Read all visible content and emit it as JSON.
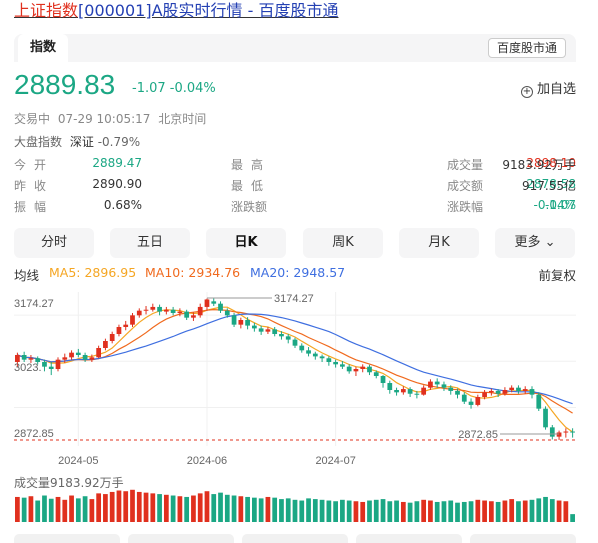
{
  "page": {
    "title_prefix": "上证指数",
    "title_link": "[000001]A股实时行情 - 百度股市通"
  },
  "header": {
    "tab_label": "指数",
    "source_tag": "百度股市通"
  },
  "quote": {
    "price": "2889.83",
    "change": "-1.07",
    "change_pct": "-0.04%",
    "add_fav": "加自选",
    "status": "交易中",
    "time": "07-29 10:05:17",
    "tz": "北京时间",
    "market_label": "大盘指数",
    "market_name": "深证",
    "market_pct": "-0.79%"
  },
  "stats": [
    [
      {
        "label": "今开",
        "value": "2889.47",
        "color": "#1ba784"
      },
      {
        "label": "最高",
        "value": "2898.10",
        "color": "#e0301e"
      },
      {
        "label": "成交量",
        "value": "9183.92万手",
        "color": "#333333"
      }
    ],
    [
      {
        "label": "昨收",
        "value": "2890.90",
        "color": "#333333"
      },
      {
        "label": "最低",
        "value": "2878.58",
        "color": "#1ba784"
      },
      {
        "label": "成交额",
        "value": "917.55亿",
        "color": "#333333"
      }
    ],
    [
      {
        "label": "振幅",
        "value": "0.68%",
        "color": "#333333"
      },
      {
        "label": "涨跌额",
        "value": "-1.07",
        "color": "#1ba784"
      },
      {
        "label": "涨跌幅",
        "value": "-0.04%",
        "color": "#1ba784"
      }
    ]
  ],
  "periods": [
    "分时",
    "五日",
    "日K",
    "周K",
    "月K",
    "更多"
  ],
  "active_period": "日K",
  "indicators": {
    "label": "均线",
    "ma5": "MA5: 2896.95",
    "ma10": "MA10: 2934.76",
    "ma20": "MA20: 2948.57",
    "adjust": "前复权"
  },
  "colors": {
    "up": "#e0301e",
    "down": "#1ba784",
    "ma5": "#f5a623",
    "ma10": "#f06a1e",
    "ma20": "#3f6fe0"
  },
  "chart_data": {
    "type": "candlestick",
    "y_high_label": "3174.27",
    "y_low_label": "2872.85",
    "y_mid_label": "3023.",
    "max_annotation": "3174.27",
    "min_annotation": "2872.85",
    "ylim": [
      2860,
      3190
    ],
    "x_labels": [
      "2024-05",
      "2024-06",
      "2024-07"
    ],
    "x_label_index": [
      9,
      28,
      47
    ],
    "candles": [
      [
        3040,
        3055,
        3030,
        3060
      ],
      [
        3055,
        3045,
        3040,
        3062
      ],
      [
        3045,
        3048,
        3038,
        3055
      ],
      [
        3048,
        3040,
        3035,
        3052
      ],
      [
        3040,
        3030,
        3020,
        3045
      ],
      [
        3030,
        3025,
        3012,
        3040
      ],
      [
        3025,
        3045,
        3020,
        3050
      ],
      [
        3045,
        3050,
        3038,
        3058
      ],
      [
        3050,
        3060,
        3045,
        3065
      ],
      [
        3060,
        3055,
        3050,
        3068
      ],
      [
        3055,
        3045,
        3040,
        3060
      ],
      [
        3045,
        3050,
        3040,
        3056
      ],
      [
        3050,
        3070,
        3048,
        3075
      ],
      [
        3070,
        3085,
        3065,
        3090
      ],
      [
        3085,
        3100,
        3080,
        3105
      ],
      [
        3100,
        3115,
        3095,
        3120
      ],
      [
        3115,
        3120,
        3108,
        3128
      ],
      [
        3120,
        3140,
        3115,
        3145
      ],
      [
        3140,
        3150,
        3135,
        3155
      ],
      [
        3150,
        3152,
        3142,
        3160
      ],
      [
        3152,
        3158,
        3148,
        3165
      ],
      [
        3158,
        3148,
        3140,
        3163
      ],
      [
        3148,
        3152,
        3142,
        3158
      ],
      [
        3152,
        3145,
        3140,
        3158
      ],
      [
        3145,
        3148,
        3138,
        3155
      ],
      [
        3148,
        3135,
        3130,
        3152
      ],
      [
        3135,
        3140,
        3128,
        3146
      ],
      [
        3140,
        3158,
        3135,
        3165
      ],
      [
        3158,
        3174,
        3150,
        3176
      ],
      [
        3170,
        3165,
        3160,
        3176
      ],
      [
        3165,
        3150,
        3145,
        3170
      ],
      [
        3150,
        3140,
        3135,
        3155
      ],
      [
        3140,
        3120,
        3115,
        3145
      ],
      [
        3120,
        3130,
        3112,
        3135
      ],
      [
        3130,
        3118,
        3110,
        3136
      ],
      [
        3118,
        3112,
        3105,
        3124
      ],
      [
        3112,
        3105,
        3098,
        3118
      ],
      [
        3105,
        3110,
        3100,
        3115
      ],
      [
        3110,
        3100,
        3095,
        3115
      ],
      [
        3100,
        3095,
        3088,
        3106
      ],
      [
        3095,
        3088,
        3080,
        3100
      ],
      [
        3088,
        3075,
        3070,
        3092
      ],
      [
        3075,
        3065,
        3060,
        3080
      ],
      [
        3065,
        3058,
        3052,
        3072
      ],
      [
        3058,
        3052,
        3045,
        3062
      ],
      [
        3052,
        3048,
        3040,
        3056
      ],
      [
        3048,
        3040,
        3032,
        3052
      ],
      [
        3040,
        3035,
        3028,
        3045
      ],
      [
        3035,
        3030,
        3025,
        3042
      ],
      [
        3030,
        3020,
        3015,
        3035
      ],
      [
        3020,
        3025,
        3010,
        3030
      ],
      [
        3025,
        3030,
        3018,
        3035
      ],
      [
        3030,
        3018,
        3012,
        3034
      ],
      [
        3018,
        3010,
        3005,
        3022
      ],
      [
        3010,
        2995,
        2985,
        3012
      ],
      [
        2995,
        2980,
        2972,
        3000
      ],
      [
        2980,
        2975,
        2968,
        2985
      ],
      [
        2975,
        2982,
        2970,
        2988
      ],
      [
        2982,
        2972,
        2965,
        2986
      ],
      [
        2972,
        2970,
        2962,
        2978
      ],
      [
        2970,
        2985,
        2968,
        2990
      ],
      [
        2985,
        2998,
        2980,
        3003
      ],
      [
        2998,
        2992,
        2985,
        3005
      ],
      [
        2992,
        2985,
        2978,
        2998
      ],
      [
        2985,
        2978,
        2970,
        2990
      ],
      [
        2978,
        2970,
        2962,
        2983
      ],
      [
        2970,
        2955,
        2950,
        2975
      ],
      [
        2955,
        2948,
        2940,
        2962
      ],
      [
        2948,
        2965,
        2945,
        2970
      ],
      [
        2965,
        2975,
        2960,
        2980
      ],
      [
        2975,
        2978,
        2968,
        2983
      ],
      [
        2978,
        2972,
        2965,
        2982
      ],
      [
        2972,
        2980,
        2968,
        2986
      ],
      [
        2980,
        2985,
        2975,
        2990
      ],
      [
        2985,
        2978,
        2972,
        2990
      ],
      [
        2978,
        2982,
        2972,
        2988
      ],
      [
        2982,
        2970,
        2962,
        2988
      ],
      [
        2970,
        2940,
        2935,
        2975
      ],
      [
        2940,
        2900,
        2895,
        2945
      ],
      [
        2900,
        2880,
        2874,
        2905
      ],
      [
        2880,
        2889,
        2873,
        2893
      ],
      [
        2889,
        2891,
        2878,
        2898
      ],
      [
        2891,
        2890,
        2878,
        2898
      ]
    ],
    "volume": [
      70,
      68,
      72,
      60,
      74,
      65,
      70,
      62,
      74,
      66,
      72,
      64,
      80,
      78,
      84,
      88,
      86,
      90,
      84,
      82,
      80,
      78,
      76,
      74,
      72,
      70,
      74,
      80,
      86,
      78,
      82,
      76,
      74,
      72,
      70,
      68,
      66,
      70,
      68,
      64,
      66,
      62,
      60,
      66,
      64,
      62,
      60,
      58,
      62,
      60,
      58,
      56,
      60,
      62,
      64,
      58,
      60,
      56,
      54,
      58,
      62,
      60,
      56,
      58,
      60,
      54,
      56,
      58,
      62,
      60,
      58,
      56,
      60,
      64,
      58,
      60,
      62,
      66,
      70,
      64,
      60,
      58,
      22
    ]
  }
}
